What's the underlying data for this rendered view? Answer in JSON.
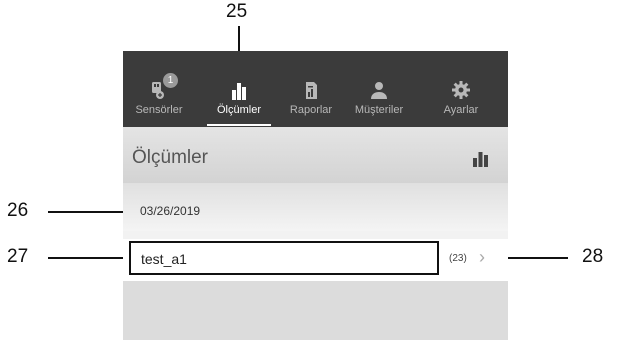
{
  "callouts": {
    "c25": "25",
    "c26": "26",
    "c27": "27",
    "c28": "28"
  },
  "tabs": [
    {
      "label": "Sensörler",
      "icon": "sensor-icon",
      "badge": "1",
      "active": false
    },
    {
      "label": "Ölçümler",
      "icon": "bar-chart-icon",
      "active": true
    },
    {
      "label": "Raporlar",
      "icon": "report-icon",
      "active": false
    },
    {
      "label": "Müşteriler",
      "icon": "customers-icon",
      "active": false
    },
    {
      "label": "Ayarlar",
      "icon": "gear-icon",
      "active": false
    }
  ],
  "header": {
    "title": "Ölçümler",
    "action_icon": "bar-chart-icon"
  },
  "date_group": {
    "date": "03/26/2019"
  },
  "measurements": [
    {
      "name": "test_a1",
      "count": "(23)"
    }
  ],
  "colors": {
    "tabbar_bg": "#3b3b3b",
    "tab_active": "#ffffff",
    "tab_inactive": "#b8b8b8"
  }
}
